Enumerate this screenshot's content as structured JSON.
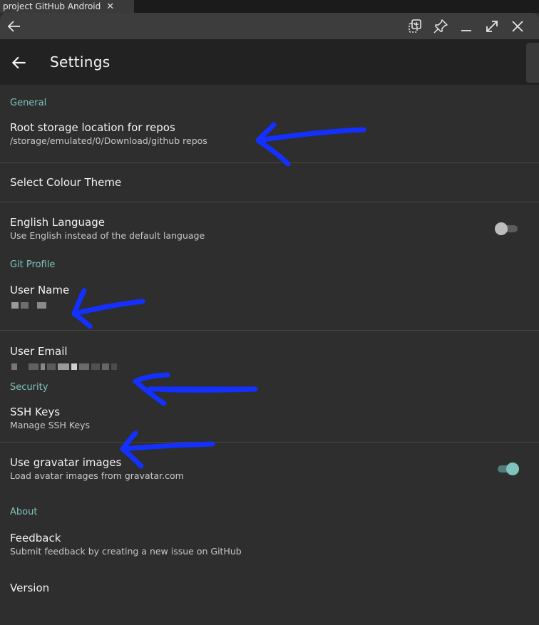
{
  "host_tab": {
    "label": "project GitHub Android",
    "close_glyph": "✕"
  },
  "app_bar": {
    "title": "Settings"
  },
  "colors": {
    "accent": "#7fc4bd",
    "arrow": "#1330ff",
    "background": "#2e2e2e"
  },
  "sections": {
    "general": {
      "header": "General",
      "root_storage": {
        "title": "Root storage location for repos",
        "subtitle": "/storage/emulated/0/Download/github repos"
      },
      "colour_theme": {
        "title": "Select Colour Theme"
      },
      "english_language": {
        "title": "English Language",
        "subtitle": "Use English instead of the default language",
        "enabled": false
      }
    },
    "git_profile": {
      "header": "Git Profile",
      "user_name": {
        "title": "User Name",
        "value_redacted": true
      },
      "user_email": {
        "title": "User Email",
        "value_redacted": true
      }
    },
    "security": {
      "header": "Security",
      "ssh_keys": {
        "title": "SSH Keys",
        "subtitle": "Manage SSH Keys"
      },
      "gravatar": {
        "title": "Use gravatar images",
        "subtitle": "Load avatar images from gravatar.com",
        "enabled": true
      }
    },
    "about": {
      "header": "About",
      "feedback": {
        "title": "Feedback",
        "subtitle": "Submit feedback by creating a new issue on GitHub"
      },
      "version": {
        "title": "Version"
      }
    }
  },
  "icons": {
    "window_back": "arrow-left-icon",
    "window_controls": [
      "copy-window-icon",
      "pin-icon",
      "minimize-icon",
      "maximize-icon",
      "close-icon"
    ],
    "app_back": "arrow-left-icon"
  }
}
